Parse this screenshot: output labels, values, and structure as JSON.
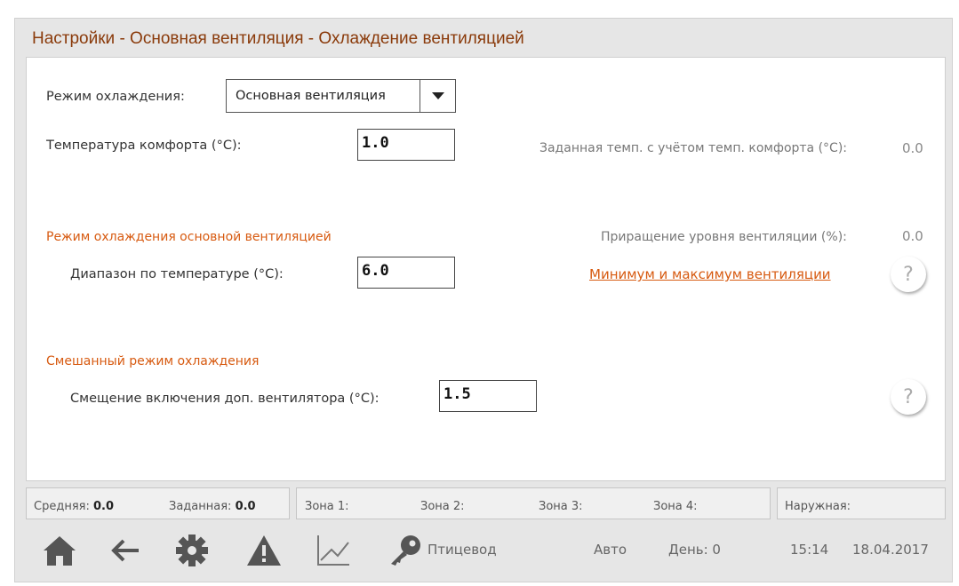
{
  "title": "Настройки - Основная вентиляция - Охлаждение вентиляцией",
  "cooling_mode": {
    "label": "Режим охлаждения:",
    "selected": "Основная вентиляция"
  },
  "comfort_temp": {
    "label": "Температура комфорта (°C):",
    "value": "1.0"
  },
  "set_temp": {
    "label": "Заданная темп. с учётом темп. комфорта (°C):",
    "value": "0.0"
  },
  "main_vent_section": {
    "heading": "Режим охлаждения основной вентиляцией",
    "range_label": "Диапазон по температуре (°C):",
    "range_value": "6.0",
    "increment_label": "Приращение уровня вентиляции (%):",
    "increment_value": "0.0",
    "link": "Минимум и максимум вентиляции"
  },
  "mixed_section": {
    "heading": "Смешанный режим охлаждения",
    "offset_label": "Смещение включения доп. вентилятора (°C):",
    "offset_value": "1.5"
  },
  "help_symbol": "?",
  "status": {
    "avg_label": "Средняя:",
    "avg_value": "0.0",
    "set_label": "Заданная:",
    "set_value": "0.0",
    "zone1": "Зона 1:",
    "zone2": "Зона 2:",
    "zone3": "Зона 3:",
    "zone4": "Зона 4:",
    "outside": "Наружная:"
  },
  "bottom": {
    "user": "Птицевод",
    "mode": "Авто",
    "day": "День: 0",
    "time": "15:14",
    "date": "18.04.2017"
  },
  "icons": [
    "home-icon",
    "back-arrow-icon",
    "gear-icon",
    "warning-icon",
    "chart-icon",
    "key-icon"
  ],
  "colors": {
    "title": "#8a3a0a",
    "accent": "#d75a10",
    "icon": "#555555"
  }
}
